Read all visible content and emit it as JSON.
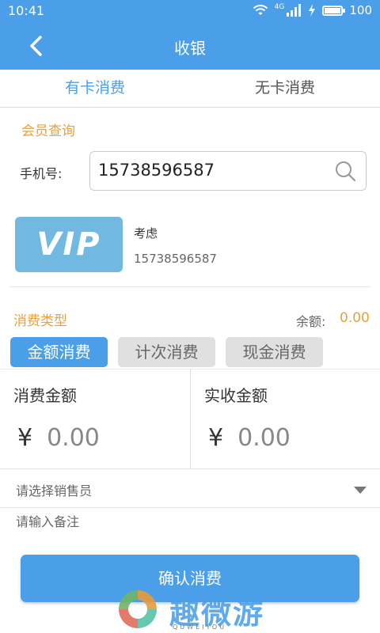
{
  "status_bar": {
    "time": "10:41",
    "network": "4G",
    "battery": "100",
    "battery_level": 1.0
  },
  "app_bar": {
    "title": "收银",
    "back_icon": "chevron-left-icon"
  },
  "tabs": [
    {
      "label": "有卡消费",
      "active": true
    },
    {
      "label": "无卡消费",
      "active": false
    }
  ],
  "member_query": {
    "section_title": "会员查询",
    "phone_label": "手机号:",
    "phone_value": "15738596587",
    "search_icon": "search-icon"
  },
  "member": {
    "card_text": "VIP",
    "name": "考虑",
    "phone": "15738596587"
  },
  "consumption": {
    "section_title": "消费类型",
    "balance_label": "余额:",
    "balance_value": "0.00",
    "types": [
      {
        "label": "金额消费",
        "active": true
      },
      {
        "label": "计次消费",
        "active": false
      },
      {
        "label": "现金消费",
        "active": false
      }
    ]
  },
  "amounts": {
    "consume_label": "消费金额",
    "consume_currency": "¥",
    "consume_value": "0.00",
    "received_label": "实收金额",
    "received_currency": "¥",
    "received_value": "0.00"
  },
  "salesperson_placeholder": "请选择销售员",
  "remark_placeholder": "请输入备注",
  "confirm_label": "确认消费",
  "watermark": {
    "text": "趣微游",
    "sub": "QUWEIYOU"
  },
  "colors": {
    "primary": "#4a9fe8",
    "accent": "#e7a23a",
    "inactive_btn": "#e0e0e0"
  }
}
